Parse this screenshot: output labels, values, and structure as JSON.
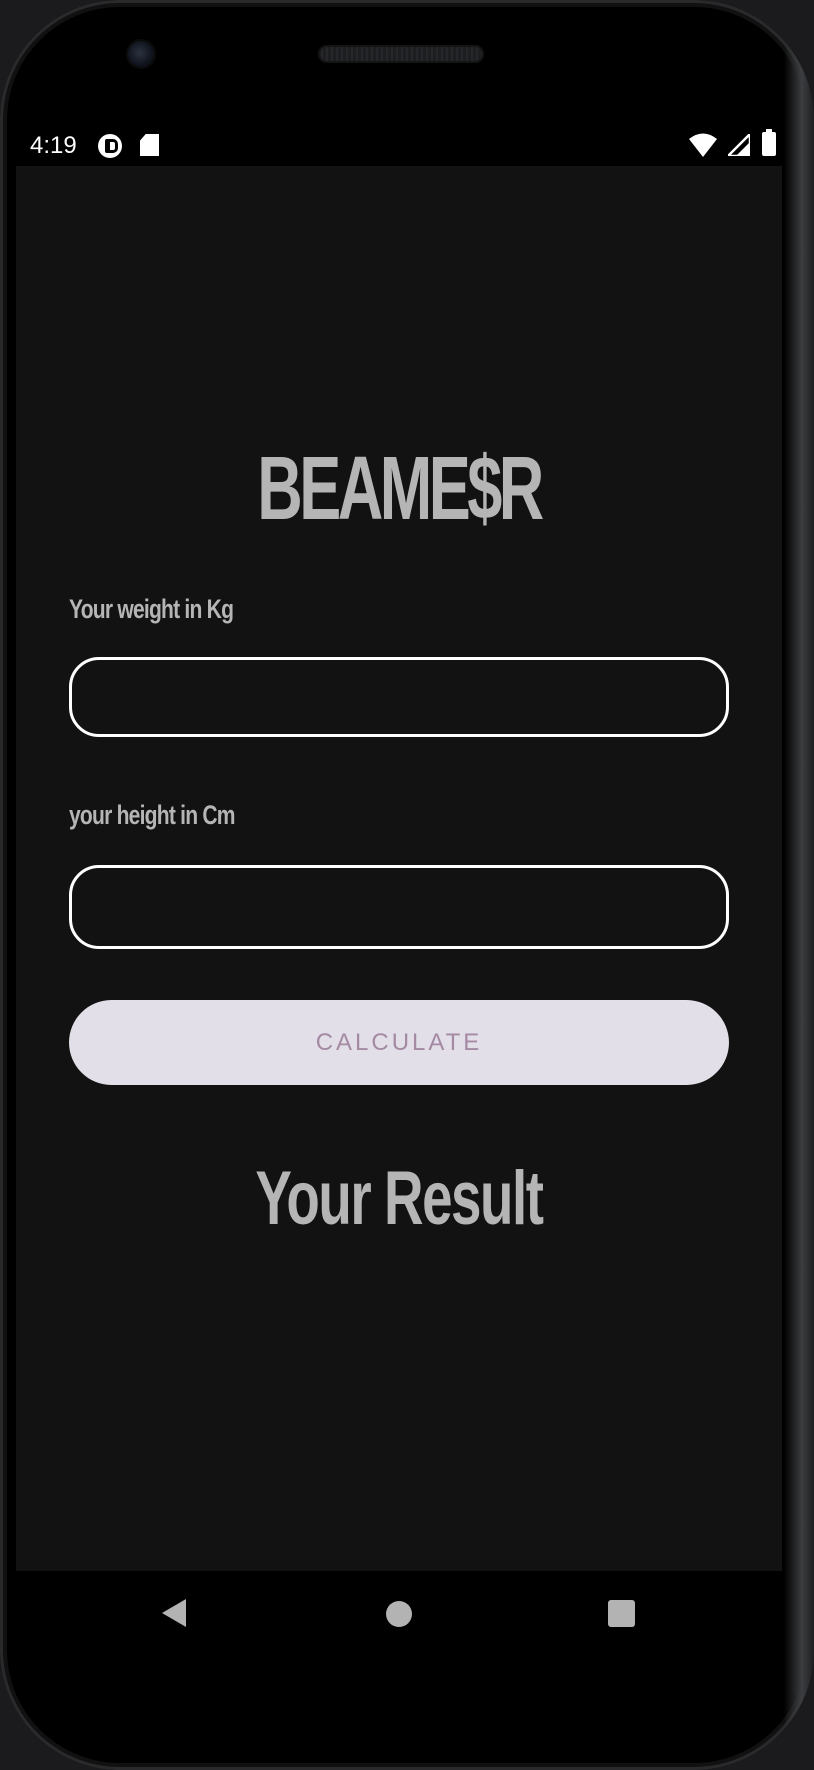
{
  "status_bar": {
    "time": "4:19",
    "icons": [
      "app-notification-icon",
      "sd-card-icon",
      "wifi-icon",
      "cell-signal-icon",
      "battery-icon"
    ]
  },
  "app": {
    "title": "BEAME$R",
    "weight_label": "Your weight in Kg",
    "weight_value": "",
    "height_label": "your height in Cm",
    "height_value": "",
    "calculate_label": "CALCULATE",
    "result_text": "Your Result"
  },
  "nav_bar": {
    "icons": [
      "back-icon",
      "home-icon",
      "recents-icon"
    ]
  },
  "colors": {
    "screen_background": "#121212",
    "text_gray": "#b5b5b5",
    "input_border": "#ffffff",
    "button_background": "#e3dfe8",
    "button_text": "#a48aa3"
  }
}
